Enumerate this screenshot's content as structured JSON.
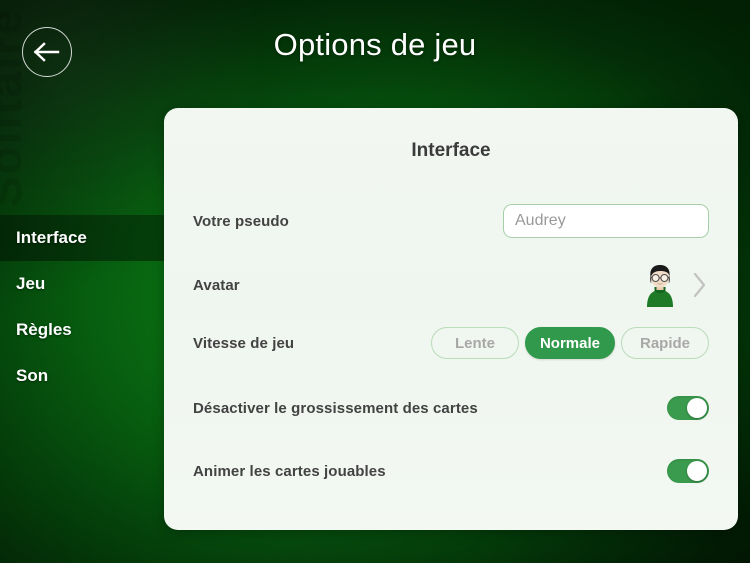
{
  "header": {
    "title": "Options de jeu",
    "back_icon": "arrow-left-icon"
  },
  "sidebar": {
    "watermark": "Solitaire",
    "items": [
      {
        "label": "Interface",
        "selected": true
      },
      {
        "label": "Jeu",
        "selected": false
      },
      {
        "label": "Règles",
        "selected": false
      },
      {
        "label": "Son",
        "selected": false
      }
    ]
  },
  "panel": {
    "title": "Interface",
    "rows": {
      "pseudo": {
        "label": "Votre pseudo",
        "value": "Audrey",
        "placeholder": "Audrey"
      },
      "avatar": {
        "label": "Avatar",
        "avatar_icon": "user-avatar-glasses-green-sweater",
        "chevron_icon": "chevron-right-icon"
      },
      "speed": {
        "label": "Vitesse de jeu",
        "options": [
          "Lente",
          "Normale",
          "Rapide"
        ],
        "selected": "Normale"
      },
      "zoom_disable": {
        "label": "Désactiver le grossissement des cartes",
        "state": "on"
      },
      "animate_cards": {
        "label": "Animer les cartes jouables",
        "state": "on"
      }
    }
  },
  "colors": {
    "accent_green": "#31994b",
    "toggle_on": "#3a9b4e",
    "panel_bg": "#f1f6f1",
    "background_green": "#0a7a12",
    "label_text": "#434343"
  }
}
